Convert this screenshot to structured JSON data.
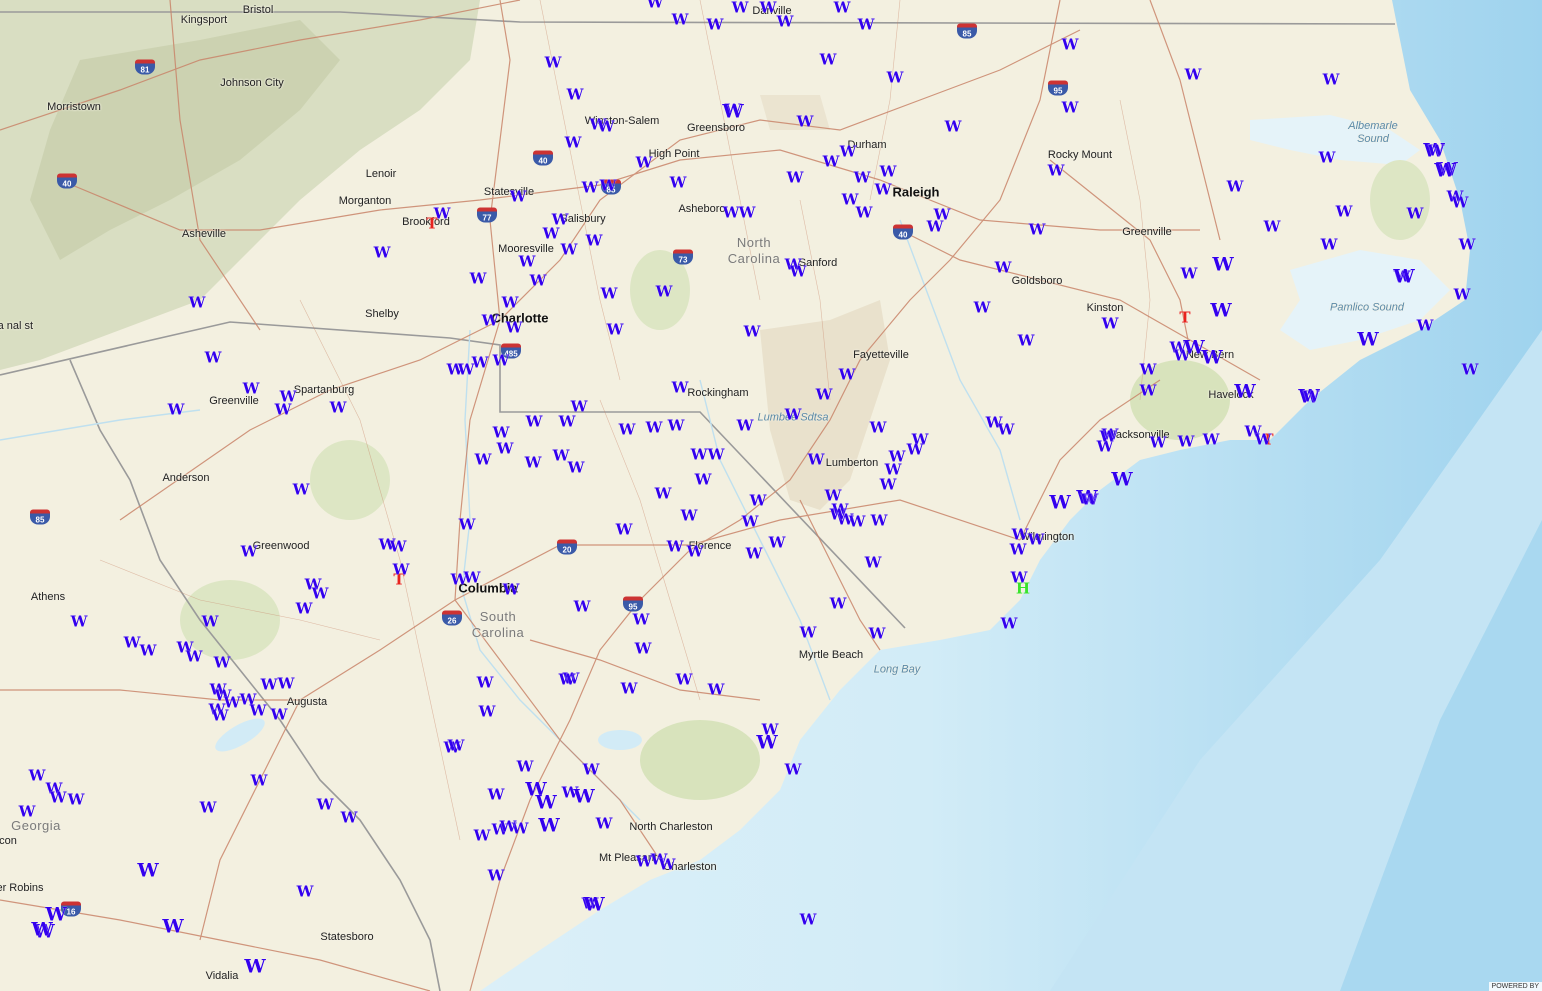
{
  "map": {
    "attribution": "POWERED BY",
    "colors": {
      "land": "#f3f0e0",
      "ocean": "#e3f1f8",
      "deep_ocean": "#a8d6ef",
      "mountains": "#d7dcc0",
      "forest": "#dde6c4",
      "road": "#c9856a",
      "interstate": "#b85f3a",
      "state_line": "#9a9a9a",
      "marker_w": "#3300ee",
      "marker_t": "#e8231e",
      "marker_h": "#39e32b"
    },
    "state_labels": [
      {
        "text": "North\nCarolina"
      },
      {
        "text": "South\nCarolina"
      },
      {
        "text": "Georgia"
      }
    ],
    "water_labels": [
      {
        "text": "Albemarle\nSound"
      },
      {
        "text": "Pamlico Sound"
      },
      {
        "text": "Long Bay"
      }
    ],
    "cities": [
      {
        "name": "Kingsport"
      },
      {
        "name": "Bristol"
      },
      {
        "name": "Johnson City"
      },
      {
        "name": "Morristown"
      },
      {
        "name": "Lenoir"
      },
      {
        "name": "Morganton"
      },
      {
        "name": "Asheville"
      },
      {
        "name": "Brookford"
      },
      {
        "name": "Statesville"
      },
      {
        "name": "Salisbury"
      },
      {
        "name": "Mooresville"
      },
      {
        "name": "Shelby"
      },
      {
        "name": "Charlotte"
      },
      {
        "name": "Winston-Salem"
      },
      {
        "name": "Greensboro"
      },
      {
        "name": "High Point"
      },
      {
        "name": "Asheboro"
      },
      {
        "name": "Danville"
      },
      {
        "name": "Durham"
      },
      {
        "name": "Raleigh"
      },
      {
        "name": "Sanford"
      },
      {
        "name": "Rocky Mount"
      },
      {
        "name": "Greenville"
      },
      {
        "name": "Goldsboro"
      },
      {
        "name": "Kinston"
      },
      {
        "name": "New Bern"
      },
      {
        "name": "Havelock"
      },
      {
        "name": "Jacksonville"
      },
      {
        "name": "Fayetteville"
      },
      {
        "name": "Rockingham"
      },
      {
        "name": "Lumberton"
      },
      {
        "name": "Wilmington"
      },
      {
        "name": "Spartanburg"
      },
      {
        "name": "Greenville"
      },
      {
        "name": "Anderson"
      },
      {
        "name": "Greenwood"
      },
      {
        "name": "Columbia"
      },
      {
        "name": "Florence"
      },
      {
        "name": "Myrtle Beach"
      },
      {
        "name": "Athens"
      },
      {
        "name": "Augusta"
      },
      {
        "name": "North\nCharleston"
      },
      {
        "name": "Mt Pleasant"
      },
      {
        "name": "Charleston"
      },
      {
        "name": "Statesboro"
      },
      {
        "name": "Vidalia"
      },
      {
        "name": "er Robins"
      },
      {
        "name": "con"
      },
      {
        "name": "Lumbee Sdtsa"
      },
      {
        "name": "hala\nnal\nst"
      }
    ],
    "interstates": [
      "81",
      "40",
      "85",
      "77",
      "85",
      "40",
      "73",
      "485",
      "95",
      "40",
      "85",
      "26",
      "20",
      "95",
      "16"
    ],
    "markers": {
      "T": {
        "label": "T",
        "count": 4
      },
      "H": {
        "label": "H",
        "count": 1
      },
      "W": {
        "label": "W",
        "count": 300
      }
    }
  }
}
